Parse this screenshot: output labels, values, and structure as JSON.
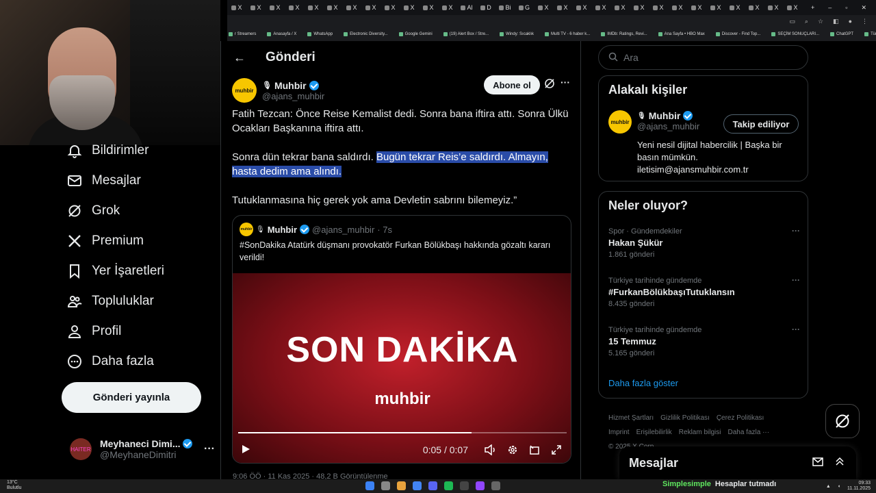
{
  "browser": {
    "tabs": [
      "X",
      "X",
      "X",
      "X",
      "X",
      "X",
      "X",
      "X",
      "X",
      "X",
      "X",
      "X",
      "Al",
      "D",
      "Bi",
      "G",
      "X",
      "X",
      "X",
      "X",
      "X",
      "X",
      "X",
      "X",
      "X",
      "X",
      "X",
      "X",
      "X",
      "X"
    ],
    "bookmarks": [
      "r Streamers",
      "Anasayfa / X",
      "WhatsApp",
      "Electronic Diversity...",
      "Google Gemini",
      "(19) Alert Box / Stre...",
      "Windy: Sıcaklık",
      "Multi TV - 6 haber k...",
      "IMDb: Ratings, Revi...",
      "Ana Sayfa • HBO Max",
      "Discover - Find Top...",
      "SEÇİM SONUÇLARI...",
      "ChatGPT",
      "Tüm Yer İşaretleri"
    ]
  },
  "sidebar": {
    "items": [
      {
        "label": "Bildirimler",
        "icon": "bell-icon"
      },
      {
        "label": "Mesajlar",
        "icon": "envelope-icon"
      },
      {
        "label": "Grok",
        "icon": "grok-icon"
      },
      {
        "label": "Premium",
        "icon": "x-logo-icon"
      },
      {
        "label": "Yer İşaretleri",
        "icon": "bookmark-icon"
      },
      {
        "label": "Topluluklar",
        "icon": "communities-icon"
      },
      {
        "label": "Profil",
        "icon": "person-icon"
      },
      {
        "label": "Daha fazla",
        "icon": "more-circle-icon"
      }
    ],
    "post_button": "Gönderi yayınla",
    "account": {
      "name": "Meyhaneci Dimi...",
      "handle": "@MeyhaneDimitri",
      "avatar_text": "HAITER"
    }
  },
  "main": {
    "title": "Gönderi",
    "author": {
      "name": "Muhbir",
      "handle": "@ajans_muhbir",
      "logo_text": "muhbir"
    },
    "subscribe_label": "Abone ol",
    "text": {
      "p1": "Fatih Tezcan: Önce Reise Kemalist dedi. Sonra bana iftira attı. Sonra Ülkü Ocakları Başkanına iftira attı.",
      "p2_plain": "Sonra dün tekrar bana saldırdı. ",
      "p2_highlight": "Bugün tekrar Reis’e saldırdı. Almayın, hasta dedim ama alındı.",
      "p3": "Tutuklanmasına hiç gerek yok ama Devletin sabrını bilemeyiz.”"
    },
    "quote": {
      "name": "Muhbir",
      "handle": "@ajans_muhbir",
      "time": "· 7s",
      "text": "#SonDakika Atatürk düşmanı provokatör Furkan Bölükbaşı hakkında gözaltı kararı verildi!",
      "video": {
        "headline": "SON DAKİKA",
        "brand": "muhbir",
        "time": "0:05 / 0:07",
        "progress": 0.71
      }
    },
    "peek_text": "9:06 ÖÖ · 11 Kas 2025 · 48,2 B Görüntülenme"
  },
  "right": {
    "search_placeholder": "Ara",
    "related": {
      "title": "Alakalı kişiler",
      "name": "Muhbir",
      "handle": "@ajans_muhbir",
      "follow_label": "Takip ediliyor",
      "bio": "Yeni nesil dijital habercilik | Başka bir basın mümkün. iletisim@ajansmuhbir.com.tr"
    },
    "trends": {
      "title": "Neler oluyor?",
      "items": [
        {
          "context": "Spor · Gündemdekiler",
          "title": "Hakan Şükür",
          "count": "1.861 gönderi"
        },
        {
          "context": "Türkiye tarihinde gündemde",
          "title": "#FurkanBölükbaşıTutuklansın",
          "count": "8.435 gönderi"
        },
        {
          "context": "Türkiye tarihinde gündemde",
          "title": "15 Temmuz",
          "count": "5.165 gönderi"
        }
      ],
      "show_more": "Daha fazla göster"
    },
    "footer": [
      "Hizmet Şartları",
      "Gizlilik Politikası",
      "Çerez Politikası",
      "Imprint",
      "Erişilebilirlik",
      "Reklam bilgisi",
      "Daha fazla ···",
      "© 2025 X Corp."
    ],
    "messages_title": "Mesajlar"
  },
  "taskbar": {
    "weather": "13°C",
    "weather_sub": "Bulutlu",
    "notice_brand": "Simplesimple",
    "notice_text": "Hesaplar tutmadı",
    "clock": "09:33",
    "date": "11.11.2025"
  }
}
